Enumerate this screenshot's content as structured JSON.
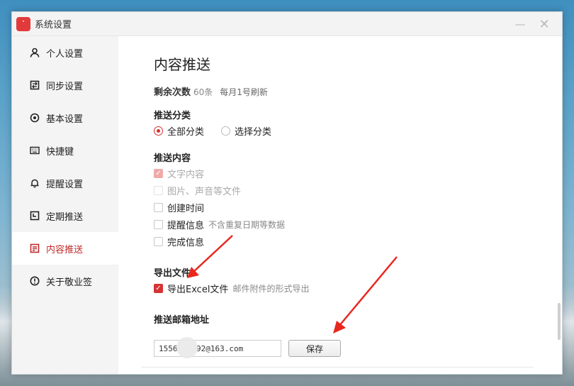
{
  "window": {
    "title": "系统设置",
    "logo_text": "ᐝ",
    "minimize_glyph": "—",
    "close_glyph": "✕"
  },
  "sidebar": {
    "items": [
      {
        "label": "个人设置",
        "icon": "person-icon",
        "active": false
      },
      {
        "label": "同步设置",
        "icon": "sync-icon",
        "active": false
      },
      {
        "label": "基本设置",
        "icon": "gear-icon",
        "active": false
      },
      {
        "label": "快捷键",
        "icon": "keyboard-icon",
        "active": false
      },
      {
        "label": "提醒设置",
        "icon": "bell-icon",
        "active": false
      },
      {
        "label": "定期推送",
        "icon": "calendar-icon",
        "active": false
      },
      {
        "label": "内容推送",
        "icon": "document-icon",
        "active": true
      },
      {
        "label": "关于敬业签",
        "icon": "info-icon",
        "active": false
      }
    ]
  },
  "content": {
    "title": "内容推送",
    "remaining": {
      "label": "剩余次数",
      "count": "60条",
      "refresh": "每月1号刷新"
    },
    "category": {
      "label": "推送分类",
      "options": [
        {
          "label": "全部分类",
          "checked": true
        },
        {
          "label": "选择分类",
          "checked": false
        }
      ]
    },
    "push_content": {
      "label": "推送内容",
      "options": [
        {
          "label": "文字内容",
          "checked": true,
          "disabled": true,
          "hint": ""
        },
        {
          "label": "图片、声音等文件",
          "checked": false,
          "disabled": true,
          "hint": ""
        },
        {
          "label": "创建时间",
          "checked": false,
          "disabled": false,
          "hint": ""
        },
        {
          "label": "提醒信息",
          "checked": false,
          "disabled": false,
          "hint": "不含重复日期等数据"
        },
        {
          "label": "完成信息",
          "checked": false,
          "disabled": false,
          "hint": ""
        }
      ]
    },
    "export": {
      "label": "导出文件",
      "option_label": "导出Excel文件",
      "option_checked": true,
      "hint": "邮件附件的形式导出"
    },
    "email": {
      "label": "推送邮箱地址",
      "value": "1556    92@163.com",
      "save_label": "保存"
    }
  },
  "colors": {
    "accent": "#d63333",
    "arrow": "#e8281f"
  }
}
